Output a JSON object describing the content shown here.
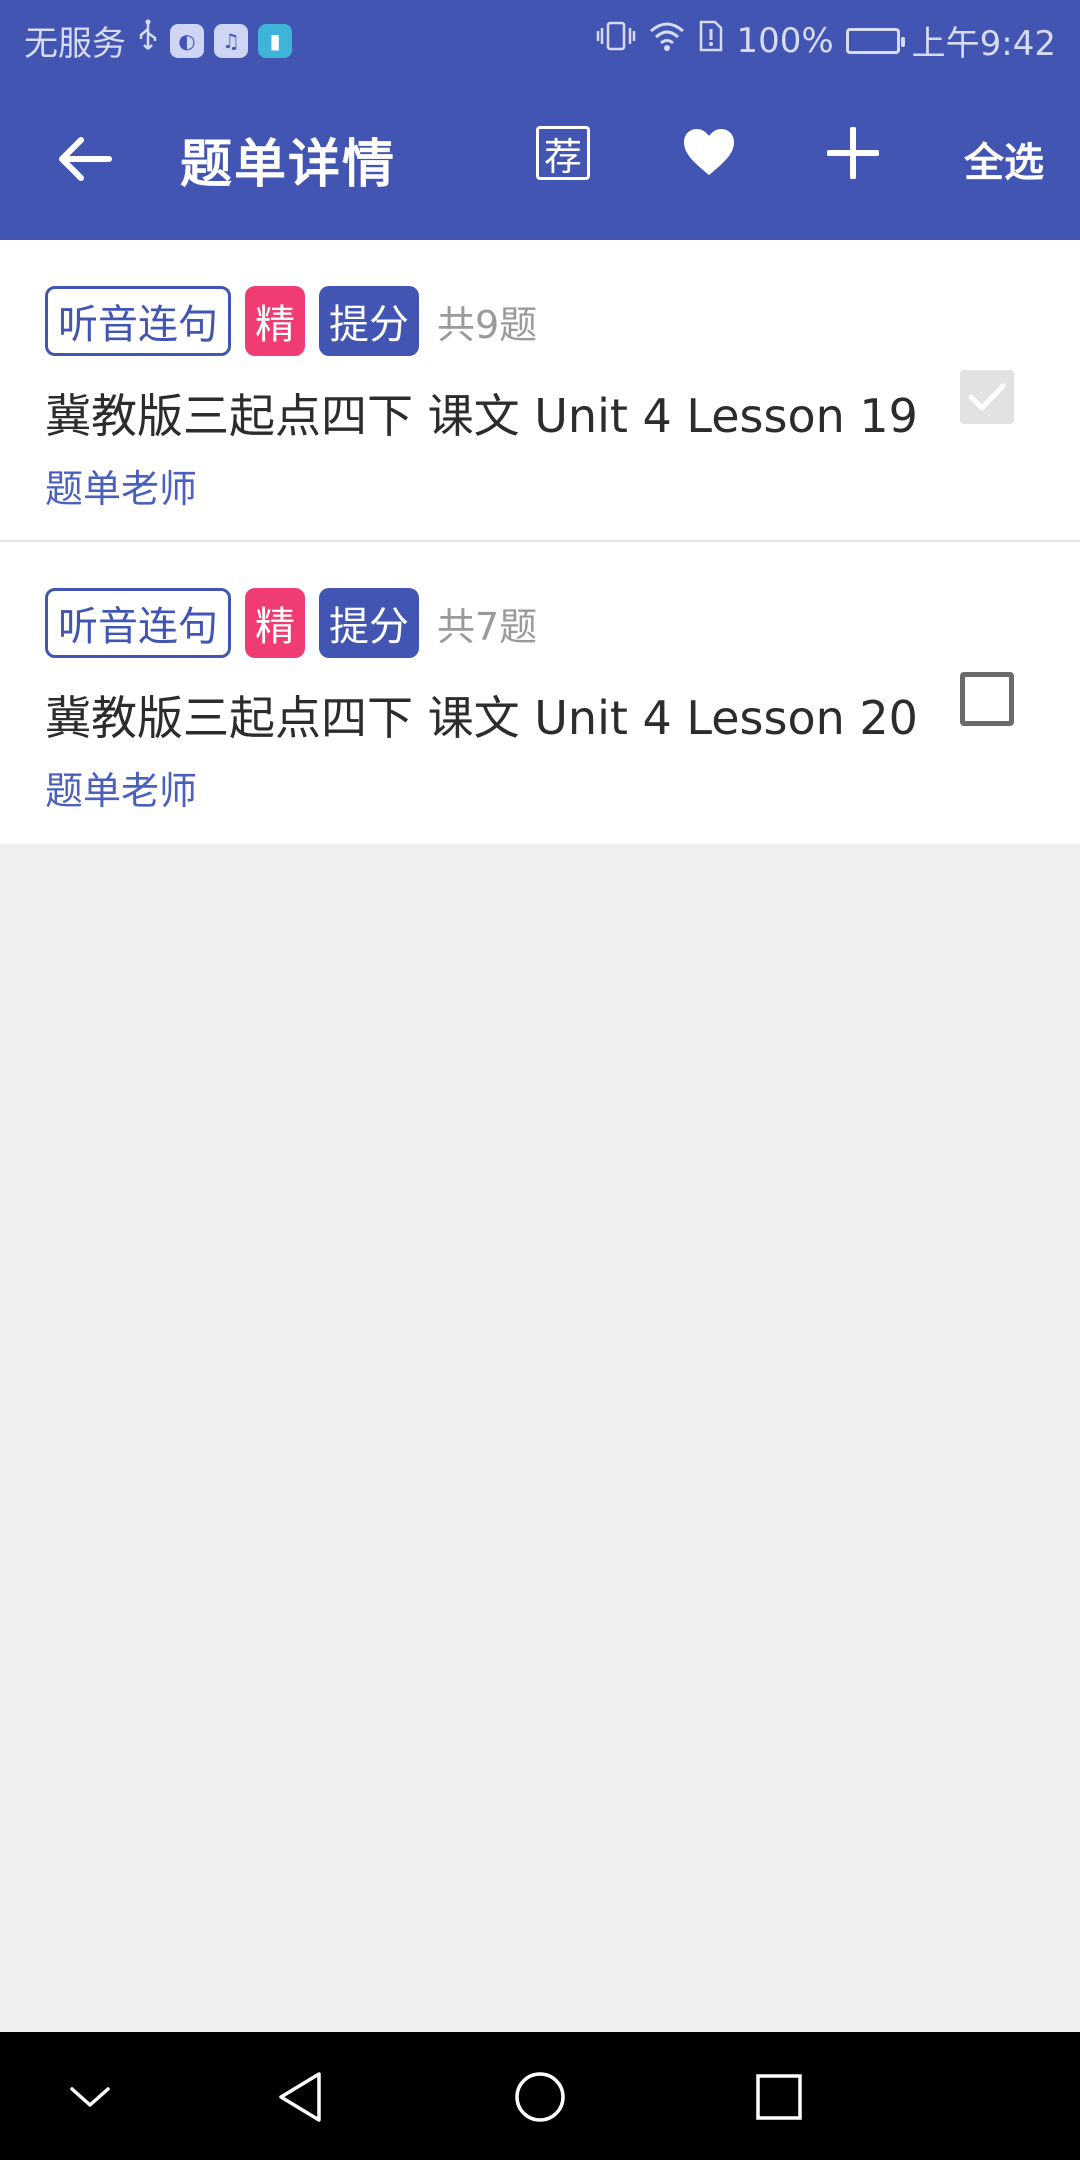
{
  "status_bar": {
    "carrier": "无服务",
    "battery_percent": "100%",
    "time": "上午9:42"
  },
  "app_bar": {
    "title": "题单详情",
    "recommend_label": "荐",
    "select_all_label": "全选"
  },
  "items": [
    {
      "type_tag": "听音连句",
      "featured_tag": "精",
      "improve_tag": "提分",
      "count": "共9题",
      "title": "冀教版三起点四下 课文 Unit 4 Lesson 19",
      "author": "题单老师",
      "checked": true
    },
    {
      "type_tag": "听音连句",
      "featured_tag": "精",
      "improve_tag": "提分",
      "count": "共7题",
      "title": "冀教版三起点四下 课文 Unit 4 Lesson 20",
      "author": "题单老师",
      "checked": false
    }
  ],
  "colors": {
    "primary": "#4255b3",
    "featured": "#f13b73",
    "author": "#4b5fbf",
    "background": "#efefef"
  },
  "icons": {
    "back": "arrow-left-icon",
    "favorite": "heart-icon",
    "add": "plus-icon",
    "nav_down": "chevron-down-icon",
    "nav_back": "triangle-back-icon",
    "nav_home": "circle-home-icon",
    "nav_recents": "square-recents-icon"
  }
}
